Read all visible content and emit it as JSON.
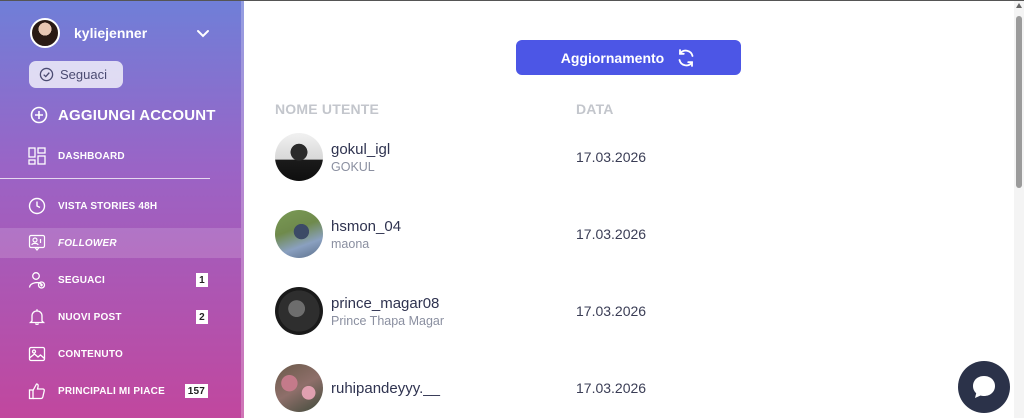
{
  "account": {
    "username": "kyliejenner"
  },
  "sidebar": {
    "followers_pill": "Seguaci",
    "add_account": "AGGIUNGI ACCOUNT",
    "items": [
      {
        "label": "DASHBOARD",
        "icon": "dashboard-icon"
      },
      {
        "label": "VISTA STORIES 48H",
        "icon": "clock-icon"
      },
      {
        "label": "FOLLOWER",
        "icon": "follower-icon",
        "active": true
      },
      {
        "label": "SEGUACI",
        "icon": "user-add-icon",
        "badge": "1"
      },
      {
        "label": "NUOVI POST",
        "icon": "bell-icon",
        "badge": "2"
      },
      {
        "label": "CONTENUTO",
        "icon": "image-icon"
      },
      {
        "label": "PRINCIPALI MI PIACE",
        "icon": "thumbs-up-icon",
        "badge": "157"
      }
    ]
  },
  "main": {
    "refresh_label": "Aggiornamento",
    "columns": {
      "user": "NOME UTENTE",
      "date": "DATA"
    },
    "rows": [
      {
        "username": "gokul_igl",
        "name": "GOKUL",
        "date": "17.03.2026"
      },
      {
        "username": "hsmon_04",
        "name": "maona",
        "date": "17.03.2026"
      },
      {
        "username": "prince_magar08",
        "name": "Prince Thapa Magar",
        "date": "17.03.2026"
      },
      {
        "username": "ruhipandeyyy.__",
        "name": "",
        "date": "17.03.2026"
      }
    ]
  },
  "colors": {
    "accent": "#4c56e6",
    "sidebar_top": "#6f7fd8",
    "sidebar_bottom": "#c1479e",
    "fab": "#2b3249"
  }
}
